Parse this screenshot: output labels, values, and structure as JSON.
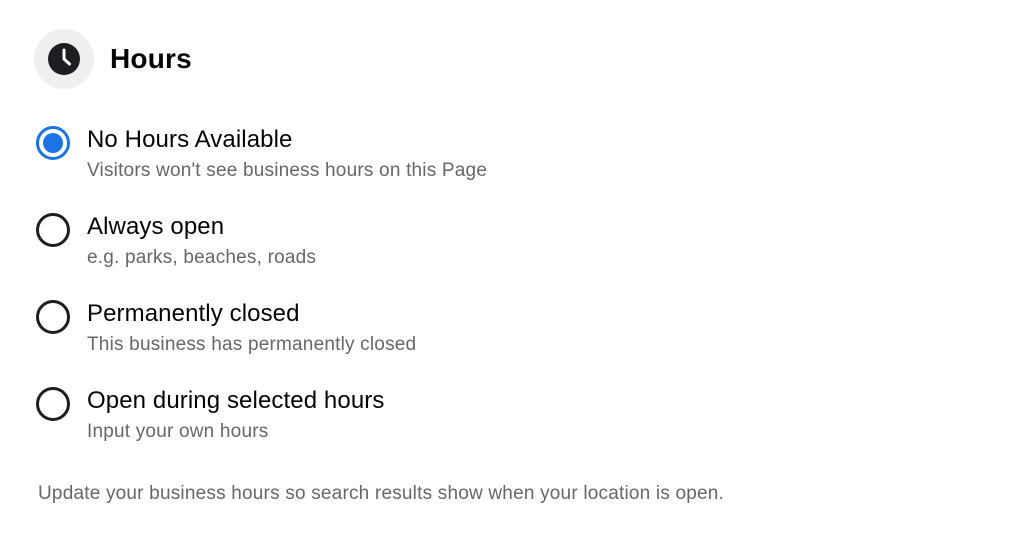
{
  "header": {
    "title": "Hours",
    "icon": "clock-icon"
  },
  "options": [
    {
      "label": "No Hours Available",
      "description": "Visitors won't see business hours on this Page",
      "selected": true
    },
    {
      "label": "Always open",
      "description": "e.g. parks, beaches, roads",
      "selected": false
    },
    {
      "label": "Permanently closed",
      "description": "This business has permanently closed",
      "selected": false
    },
    {
      "label": "Open during selected hours",
      "description": "Input your own hours",
      "selected": false
    }
  ],
  "footer": {
    "note": "Update your business hours so search results show when your location is open."
  },
  "colors": {
    "accent": "#1b74e4",
    "secondary_text": "#65676b",
    "primary_text": "#050505",
    "icon_bg": "#eeeff1"
  }
}
